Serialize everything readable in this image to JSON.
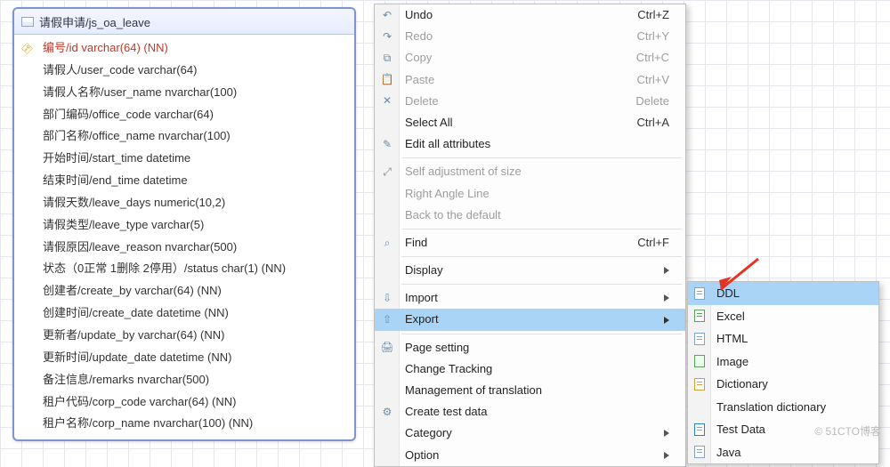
{
  "table": {
    "title": "请假申请/js_oa_leave",
    "columns": [
      {
        "pk": true,
        "text": "编号/id varchar(64) (NN)"
      },
      {
        "pk": false,
        "text": "请假人/user_code varchar(64)"
      },
      {
        "pk": false,
        "text": "请假人名称/user_name nvarchar(100)"
      },
      {
        "pk": false,
        "text": "部门编码/office_code varchar(64)"
      },
      {
        "pk": false,
        "text": "部门名称/office_name nvarchar(100)"
      },
      {
        "pk": false,
        "text": "开始时间/start_time datetime"
      },
      {
        "pk": false,
        "text": "结束时间/end_time datetime"
      },
      {
        "pk": false,
        "text": "请假天数/leave_days numeric(10,2)"
      },
      {
        "pk": false,
        "text": "请假类型/leave_type varchar(5)"
      },
      {
        "pk": false,
        "text": "请假原因/leave_reason nvarchar(500)"
      },
      {
        "pk": false,
        "text": "状态（0正常 1删除 2停用）/status char(1) (NN)"
      },
      {
        "pk": false,
        "text": "创建者/create_by varchar(64) (NN)"
      },
      {
        "pk": false,
        "text": "创建时间/create_date datetime (NN)"
      },
      {
        "pk": false,
        "text": "更新者/update_by varchar(64) (NN)"
      },
      {
        "pk": false,
        "text": "更新时间/update_date datetime (NN)"
      },
      {
        "pk": false,
        "text": "备注信息/remarks nvarchar(500)"
      },
      {
        "pk": false,
        "text": "租户代码/corp_code varchar(64) (NN)"
      },
      {
        "pk": false,
        "text": "租户名称/corp_name nvarchar(100) (NN)"
      }
    ]
  },
  "menu": {
    "items": [
      {
        "label": "Undo",
        "shortcut": "Ctrl+Z",
        "icon": "↶",
        "disabled": false
      },
      {
        "label": "Redo",
        "shortcut": "Ctrl+Y",
        "icon": "↷",
        "disabled": true
      },
      {
        "label": "Copy",
        "shortcut": "Ctrl+C",
        "icon": "⧉",
        "disabled": true
      },
      {
        "label": "Paste",
        "shortcut": "Ctrl+V",
        "icon": "📋",
        "disabled": true
      },
      {
        "label": "Delete",
        "shortcut": "Delete",
        "icon": "✕",
        "disabled": true
      },
      {
        "label": "Select All",
        "shortcut": "Ctrl+A",
        "icon": "",
        "disabled": false
      },
      {
        "label": "Edit all attributes",
        "shortcut": "",
        "icon": "✎",
        "disabled": false
      },
      {
        "sep": true
      },
      {
        "label": "Self adjustment of size",
        "shortcut": "",
        "icon": "⤢",
        "disabled": true
      },
      {
        "label": "Right Angle Line",
        "shortcut": "",
        "icon": "",
        "disabled": true
      },
      {
        "label": "Back to the default",
        "shortcut": "",
        "icon": "",
        "disabled": true
      },
      {
        "sep": true
      },
      {
        "label": "Find",
        "shortcut": "Ctrl+F",
        "icon": "⌕",
        "disabled": false
      },
      {
        "sep": true
      },
      {
        "label": "Display",
        "submenu": true,
        "icon": "",
        "disabled": false
      },
      {
        "sep": true
      },
      {
        "label": "Import",
        "submenu": true,
        "icon": "⇩",
        "disabled": false
      },
      {
        "label": "Export",
        "submenu": true,
        "icon": "⇧",
        "disabled": false,
        "hover": true
      },
      {
        "sep": true
      },
      {
        "label": "Page setting",
        "shortcut": "",
        "icon": "🖨",
        "disabled": false
      },
      {
        "label": "Change Tracking",
        "shortcut": "",
        "icon": "",
        "disabled": false
      },
      {
        "label": "Management of translation",
        "shortcut": "",
        "icon": "",
        "disabled": false
      },
      {
        "label": "Create test data",
        "shortcut": "",
        "icon": "⚙",
        "disabled": false
      },
      {
        "label": "Category",
        "submenu": true,
        "icon": "",
        "disabled": false
      },
      {
        "label": "Option",
        "submenu": true,
        "icon": "",
        "disabled": false
      }
    ]
  },
  "submenu": {
    "items": [
      {
        "label": "DDL",
        "hover": true,
        "icon": "doc"
      },
      {
        "label": "Excel",
        "icon": "green"
      },
      {
        "label": "HTML",
        "icon": "doc"
      },
      {
        "label": "Image",
        "icon": "img"
      },
      {
        "label": "Dictionary",
        "icon": "dict"
      },
      {
        "label": "Translation dictionary",
        "icon": ""
      },
      {
        "label": "Test Data",
        "icon": "data"
      },
      {
        "label": "Java",
        "icon": "doc"
      }
    ]
  },
  "watermark": "© 51CTO博客"
}
